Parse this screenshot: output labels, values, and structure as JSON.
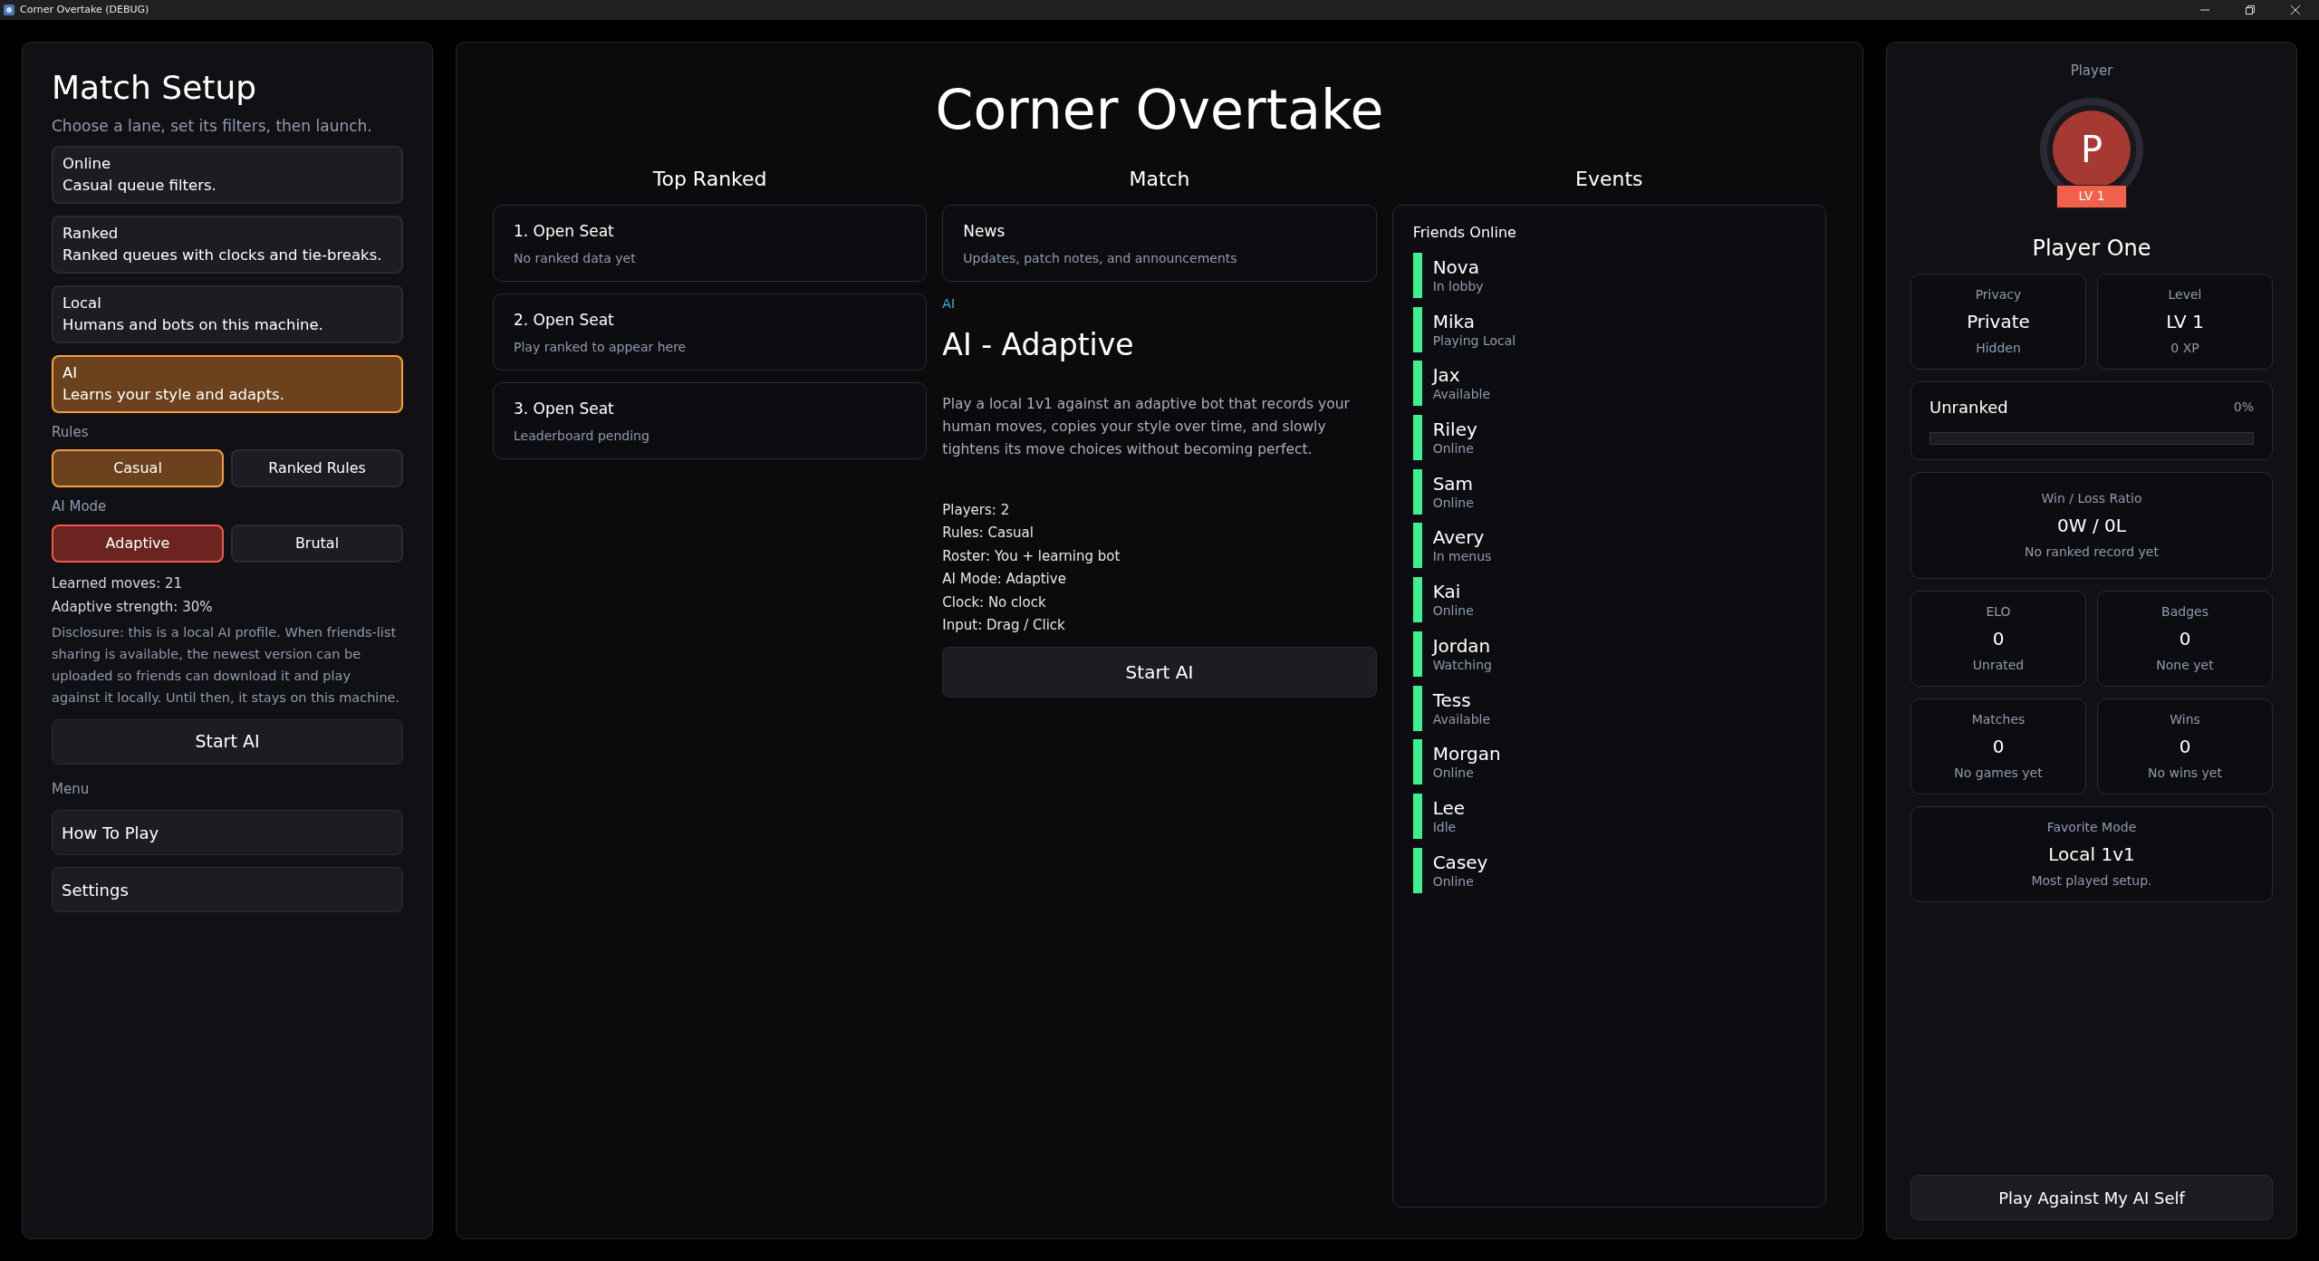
{
  "window": {
    "title": "Corner Overtake (DEBUG)"
  },
  "setup": {
    "title": "Match Setup",
    "subtitle": "Choose a lane, set its filters, then launch.",
    "lanes": [
      {
        "title": "Online",
        "description": "Casual queue filters.",
        "selected": false
      },
      {
        "title": "Ranked",
        "description": "Ranked queues with clocks and tie-breaks.",
        "selected": false
      },
      {
        "title": "Local",
        "description": "Humans and bots on this machine.",
        "selected": false
      },
      {
        "title": "AI",
        "description": "Learns your style and adapts.",
        "selected": true
      }
    ],
    "rules": {
      "label": "Rules",
      "options": [
        {
          "label": "Casual",
          "selected": true
        },
        {
          "label": "Ranked Rules",
          "selected": false
        }
      ]
    },
    "ai_mode": {
      "label": "AI Mode",
      "options": [
        {
          "label": "Adaptive",
          "selected": true
        },
        {
          "label": "Brutal",
          "selected": false
        }
      ]
    },
    "stats": [
      "Learned moves: 21",
      "Adaptive strength: 30%"
    ],
    "disclosure": "Disclosure: this is a local AI profile. When friends-list sharing is available, the newest version can be uploaded so friends can download it and play against it locally. Until then, it stays on this machine.",
    "start_button": "Start AI",
    "menu": {
      "label": "Menu",
      "items": [
        "How To Play",
        "Settings"
      ]
    }
  },
  "main": {
    "title": "Corner Overtake",
    "top_ranked": {
      "heading": "Top Ranked",
      "entries": [
        {
          "title": "1. Open Seat",
          "subtitle": "No ranked data yet"
        },
        {
          "title": "2. Open Seat",
          "subtitle": "Play ranked to appear here"
        },
        {
          "title": "3. Open Seat",
          "subtitle": "Leaderboard pending"
        }
      ]
    },
    "match": {
      "heading": "Match",
      "news": {
        "title": "News",
        "subtitle": "Updates, patch notes, and announcements"
      },
      "tag": "AI",
      "title": "AI - Adaptive",
      "description": "Play a local 1v1 against an adaptive bot that records your human moves, copies your style over time, and slowly tightens its move choices without becoming perfect.",
      "details": [
        "Players: 2",
        "Rules: Casual",
        "Roster: You + learning bot",
        "AI Mode: Adaptive",
        "Clock: No clock",
        "Input: Drag / Click"
      ],
      "start_button": "Start AI"
    },
    "events": {
      "heading": "Events",
      "friends_title": "Friends Online",
      "friends": [
        {
          "name": "Nova",
          "status": "In lobby"
        },
        {
          "name": "Mika",
          "status": "Playing Local"
        },
        {
          "name": "Jax",
          "status": "Available"
        },
        {
          "name": "Riley",
          "status": "Online"
        },
        {
          "name": "Sam",
          "status": "Online"
        },
        {
          "name": "Avery",
          "status": "In menus"
        },
        {
          "name": "Kai",
          "status": "Online"
        },
        {
          "name": "Jordan",
          "status": "Watching"
        },
        {
          "name": "Tess",
          "status": "Available"
        },
        {
          "name": "Morgan",
          "status": "Online"
        },
        {
          "name": "Lee",
          "status": "Idle"
        },
        {
          "name": "Casey",
          "status": "Online"
        }
      ]
    }
  },
  "profile": {
    "heading": "Player",
    "avatar_letter": "P",
    "level_badge": "LV 1",
    "name": "Player One",
    "identity": [
      {
        "label": "Privacy",
        "value": "Private",
        "note": "Hidden"
      },
      {
        "label": "Level",
        "value": "LV 1",
        "note": "0 XP"
      }
    ],
    "rank": {
      "title": "Unranked",
      "reading": "0%",
      "level": 0
    },
    "win_loss": {
      "label": "Win / Loss Ratio",
      "value": "0W / 0L",
      "note": "No ranked record yet"
    },
    "ratings": [
      {
        "label": "ELO",
        "value": "0",
        "note": "Unrated"
      },
      {
        "label": "Badges",
        "value": "0",
        "note": "None yet"
      }
    ],
    "activity": [
      {
        "label": "Matches",
        "value": "0",
        "note": "No games yet"
      },
      {
        "label": "Wins",
        "value": "0",
        "note": "No wins yet"
      }
    ],
    "favorite": {
      "label": "Favorite Mode",
      "value": "Local 1v1",
      "note": "Most played setup."
    },
    "play_button": "Play Against My AI Self"
  }
}
